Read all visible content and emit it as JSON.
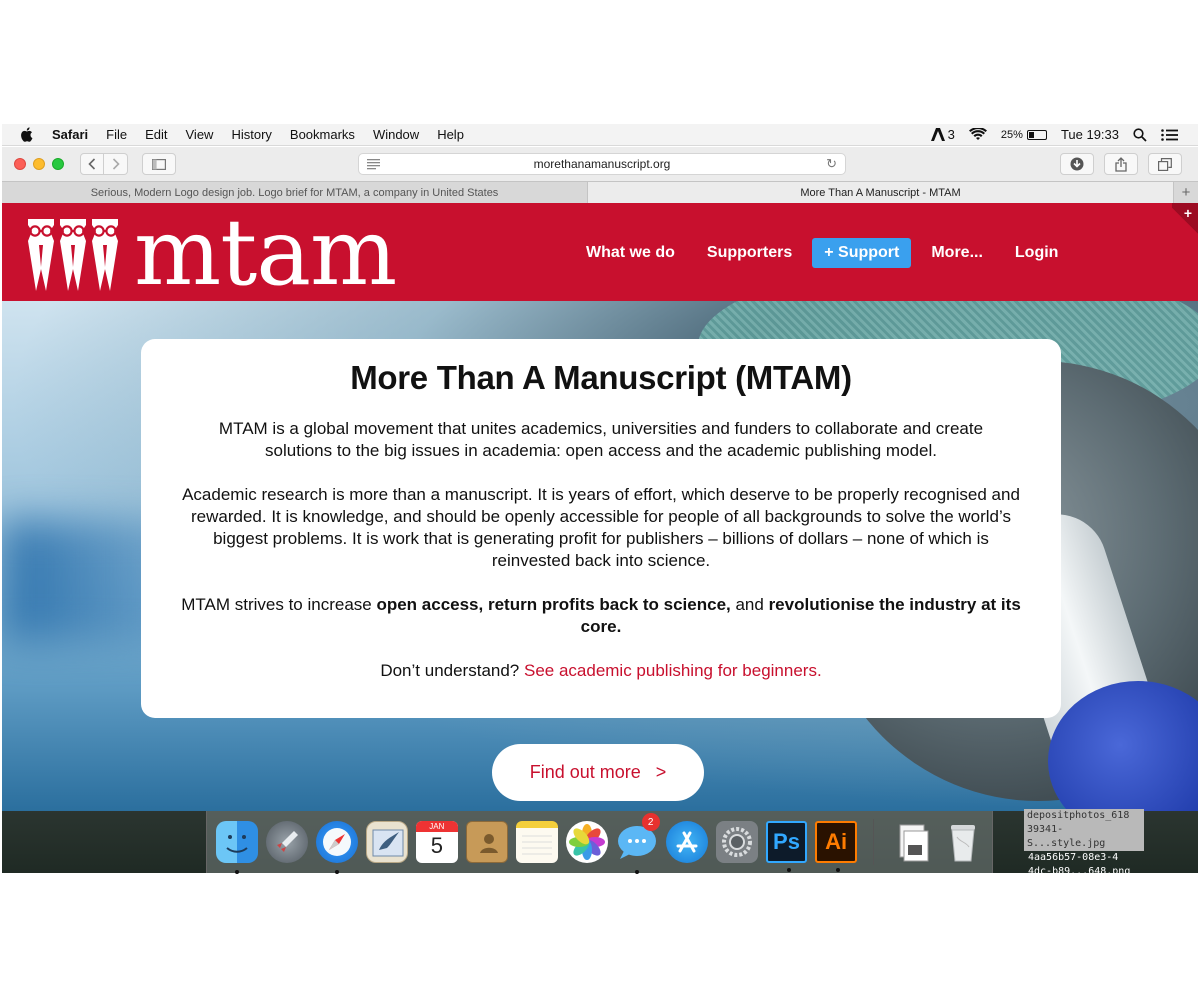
{
  "menubar": {
    "app": "Safari",
    "items": [
      "File",
      "Edit",
      "View",
      "History",
      "Bookmarks",
      "Window",
      "Help"
    ],
    "adobe_count": "3",
    "battery": "25%",
    "clock": "Tue 19:33"
  },
  "browser": {
    "url": "morethanamanuscript.org",
    "tabs": [
      "Serious, Modern Logo design job. Logo brief for MTAM, a company in United States",
      "More Than A Manuscript - MTAM"
    ]
  },
  "site": {
    "logo_text": "mtam",
    "nav": {
      "what_we_do": "What we do",
      "supporters": "Supporters",
      "support": "+ Support",
      "more": "More...",
      "login": "Login"
    },
    "corner": "+"
  },
  "card": {
    "title": "More Than A Manuscript (MTAM)",
    "p1": "MTAM is a global movement that unites academics, universities and funders to collaborate and create solutions to the big issues in academia: open access and the academic publishing model.",
    "p2": "Academic research is more than a manuscript. It is years of effort, which deserve to be properly recognised and rewarded. It is knowledge, and should be openly accessible for people of all backgrounds to solve the world’s biggest problems. It is work that is generating profit for publishers – billions of dollars – none of which is reinvested back into science.",
    "p3_start": "MTAM strives to increase ",
    "p3_bold1": "open access, return profits back to science,",
    "p3_mid": " and ",
    "p3_bold2": "revolutionise the industry at its core.",
    "p4_start": "Don’t understand? ",
    "p4_link": "See academic publishing for beginners."
  },
  "cta": {
    "label": "Find out more   >"
  },
  "dock": {
    "calendar_month": "JAN",
    "calendar_day": "5",
    "messages_badge": "2",
    "ps": "Ps",
    "ai": "Ai",
    "icons": [
      "finder-icon",
      "launchpad-icon",
      "safari-icon",
      "mail-icon",
      "calendar-icon",
      "contacts-icon",
      "notes-icon",
      "photos-icon",
      "messages-icon",
      "app-store-icon",
      "system-preferences-icon",
      "photoshop-icon",
      "illustrator-icon",
      "downloads-icon",
      "trash-icon"
    ]
  },
  "desktop_files": [
    "depositphotos_618",
    "39341-S...style.jpg",
    "4aa56b57-08e3-4",
    "4dc-b89...648.png"
  ],
  "colors": {
    "brand_red": "#c8102e",
    "support_blue": "#3aa0ee"
  }
}
